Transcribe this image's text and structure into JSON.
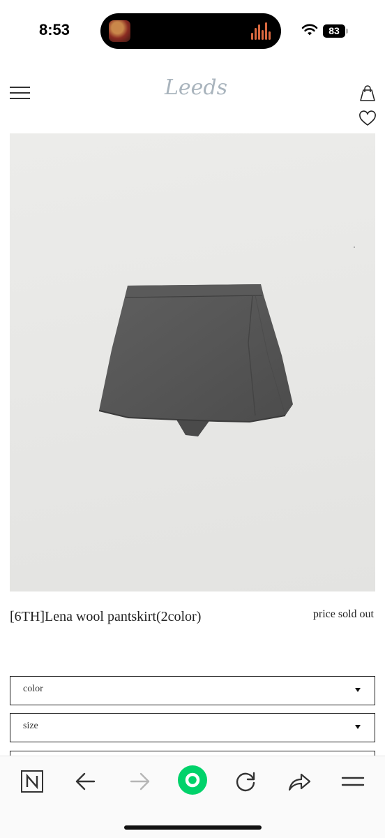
{
  "status_bar": {
    "time": "8:53",
    "battery": "83"
  },
  "header": {
    "logo": "Leeds",
    "icons": [
      "menu-icon",
      "shopping-bag-icon",
      "heart-icon"
    ]
  },
  "product": {
    "name": "[6TH]Lena wool pantskirt(2color)",
    "price_status": "price sold out"
  },
  "options": [
    {
      "label": "color"
    },
    {
      "label": "size"
    }
  ],
  "browser_toolbar": {
    "icons": [
      "naver-n-icon",
      "back-arrow-icon",
      "forward-arrow-icon",
      "green-home-icon",
      "reload-icon",
      "share-icon",
      "menu-icon"
    ],
    "accent": "#00d26a"
  }
}
